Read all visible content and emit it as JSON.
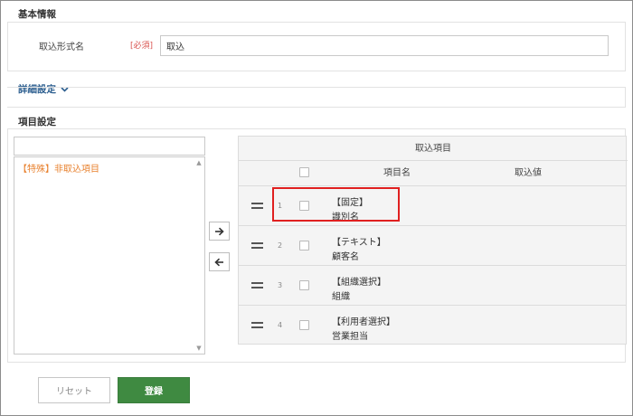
{
  "basic_info": {
    "title": "基本情報",
    "format_name_label": "取込形式名",
    "required_badge": "[必須]",
    "format_name_value": "取込"
  },
  "details": {
    "label": "詳細設定",
    "icon": "chevron-down-icon"
  },
  "item_settings": {
    "title": "項目設定",
    "left_list": {
      "search_value": "",
      "items": [
        "【特殊】非取込項目"
      ]
    },
    "table": {
      "caption": "取込項目",
      "headers": {
        "item_name": "項目名",
        "import_value": "取込値"
      },
      "rows": [
        {
          "num": "1",
          "type": "【固定】",
          "name": "識別名"
        },
        {
          "num": "2",
          "type": "【テキスト】",
          "name": "顧客名"
        },
        {
          "num": "3",
          "type": "【組織選択】",
          "name": "組織"
        },
        {
          "num": "4",
          "type": "【利用者選択】",
          "name": "営業担当"
        }
      ]
    }
  },
  "footer": {
    "reset_label": "リセット",
    "register_label": "登録"
  },
  "colors": {
    "accent_green": "#3f8a41",
    "required_red": "#d9534f",
    "special_orange": "#e8812e",
    "link_blue": "#2c5e8f",
    "highlight_red": "#e02020"
  }
}
